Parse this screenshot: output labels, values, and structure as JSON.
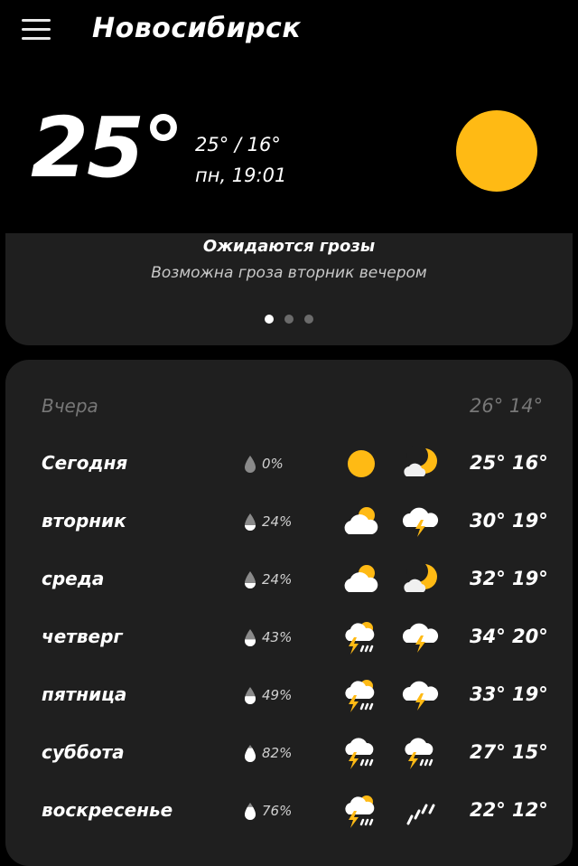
{
  "header": {
    "city": "Новосибирск"
  },
  "current": {
    "temp": "25°",
    "minmax": "25° / 16°",
    "datetime": "пн, 19:01",
    "icon": "sun-icon"
  },
  "alert": {
    "title": "Ожидаются грозы",
    "subtitle": "Возможна гроза вторник вечером",
    "page_index": 0,
    "page_count": 3
  },
  "yesterday": {
    "label": "Вчера",
    "temps": "26° 14°"
  },
  "forecast": [
    {
      "day": "Сегодня",
      "precip": "0%",
      "drop_fill": 0.0,
      "day_icon": "sun-icon",
      "night_icon": "moon-cloud-icon",
      "temps": "25° 16°"
    },
    {
      "day": "вторник",
      "precip": "24%",
      "drop_fill": 0.24,
      "day_icon": "cloud-sun-icon",
      "night_icon": "thunder-cloud-icon",
      "temps": "30° 19°"
    },
    {
      "day": "среда",
      "precip": "24%",
      "drop_fill": 0.24,
      "day_icon": "cloud-sun-icon",
      "night_icon": "moon-cloud-icon",
      "temps": "32° 19°"
    },
    {
      "day": "четверг",
      "precip": "43%",
      "drop_fill": 0.43,
      "day_icon": "thunder-rain-sun-icon",
      "night_icon": "thunder-cloud-icon",
      "temps": "34° 20°"
    },
    {
      "day": "пятница",
      "precip": "49%",
      "drop_fill": 0.49,
      "day_icon": "thunder-rain-sun-icon",
      "night_icon": "thunder-cloud-icon",
      "temps": "33° 19°"
    },
    {
      "day": "суббота",
      "precip": "82%",
      "drop_fill": 0.82,
      "day_icon": "thunder-rain-icon",
      "night_icon": "thunder-rain-icon",
      "temps": "27° 15°"
    },
    {
      "day": "воскресенье",
      "precip": "76%",
      "drop_fill": 0.76,
      "day_icon": "thunder-rain-sun-icon",
      "night_icon": "rain-icon",
      "temps": "22° 12°"
    }
  ],
  "colors": {
    "sun": "#ffba14",
    "cloud": "#ffffff",
    "card": "#1f1f1f",
    "muted": "#777777"
  }
}
